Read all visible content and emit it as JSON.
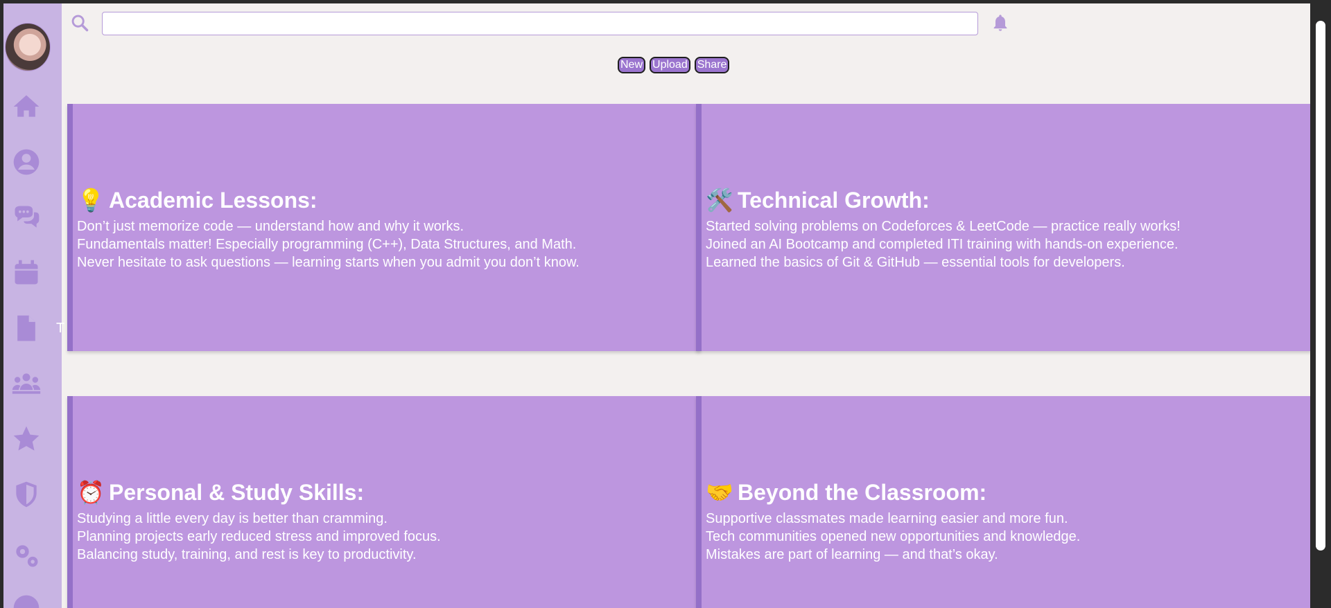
{
  "search": {
    "value": "",
    "placeholder": ""
  },
  "toolbar": {
    "new_label": "New",
    "upload_label": "Upload",
    "share_label": "Share"
  },
  "sidebar": {
    "items": [
      {
        "icon": "home-icon"
      },
      {
        "icon": "user-icon"
      },
      {
        "icon": "chat-icon"
      },
      {
        "icon": "calendar-icon"
      },
      {
        "icon": "file-icon"
      },
      {
        "icon": "group-icon"
      },
      {
        "icon": "star-icon"
      },
      {
        "icon": "shield-icon"
      },
      {
        "icon": "gears-icon"
      },
      {
        "icon": "more-icon"
      }
    ],
    "ghost_text": "T"
  },
  "cards": [
    {
      "emoji": "💡",
      "title": "Academic Lessons:",
      "lines": [
        "Don’t just memorize code — understand how and why it works.",
        "Fundamentals matter! Especially programming (C++), Data Structures, and Math.",
        "Never hesitate to ask questions — learning starts when you admit you don’t know."
      ]
    },
    {
      "emoji": "🛠️",
      "title": "Technical Growth:",
      "lines": [
        "Started solving problems on Codeforces & LeetCode — practice really works!",
        "Joined an AI Bootcamp and completed ITI training with hands-on experience.",
        "Learned the basics of Git & GitHub — essential tools for developers."
      ]
    },
    {
      "emoji": "⏰",
      "title": "Personal & Study Skills:",
      "lines": [
        "Studying a little every day is better than cramming.",
        "Planning projects early reduced stress and improved focus.",
        "Balancing study, training, and rest is key to productivity."
      ]
    },
    {
      "emoji": "🤝",
      "title": "Beyond the Classroom:",
      "lines": [
        "Supportive classmates made learning easier and more fun.",
        "Tech communities opened new opportunities and knowledge.",
        "Mistakes are part of learning — and that’s okay."
      ]
    }
  ],
  "colors": {
    "accent": "#9b75cf",
    "card_bg": "#bd96df",
    "sidebar_bg": "#c8b4e3",
    "page_bg": "#f3f0ef"
  }
}
